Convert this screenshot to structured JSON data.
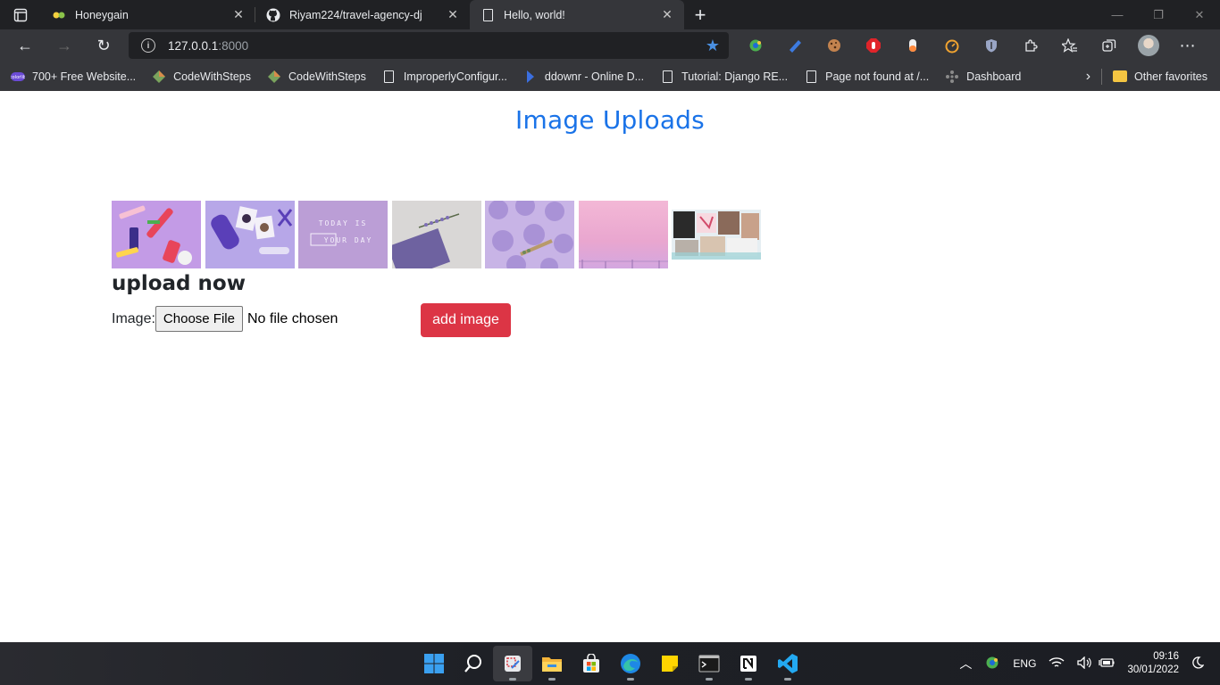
{
  "browser": {
    "tabs": [
      {
        "title": "Honeygain",
        "favicon": "honeygain-icon",
        "active": false
      },
      {
        "title": "Riyam224/travel-agency-dj",
        "favicon": "github-icon",
        "active": false
      },
      {
        "title": "Hello, world!",
        "favicon": "page-icon",
        "active": true
      }
    ],
    "address": {
      "host": "127.0.0.1",
      "port": ":8000"
    },
    "bookmarks": [
      {
        "label": "700+ Free Website...",
        "icon": "colorlib-icon"
      },
      {
        "label": "CodeWithSteps",
        "icon": "codewithsteps-icon"
      },
      {
        "label": "CodeWithSteps",
        "icon": "codewithsteps-icon"
      },
      {
        "label": "ImproperlyConfigur...",
        "icon": "page-icon"
      },
      {
        "label": "ddownr - Online D...",
        "icon": "ddownr-icon"
      },
      {
        "label": "Tutorial: Django RE...",
        "icon": "page-icon"
      },
      {
        "label": "Page not found at /...",
        "icon": "page-icon"
      },
      {
        "label": "Dashboard",
        "icon": "dashboard-icon"
      }
    ],
    "other_favorites": "Other favorites"
  },
  "page": {
    "title": "Image Uploads",
    "gallery": [
      {
        "icon": "thumbnail-purple-makeup"
      },
      {
        "icon": "thumbnail-purple-phone"
      },
      {
        "icon": "thumbnail-today-is-your-day"
      },
      {
        "icon": "thumbnail-lavender-book"
      },
      {
        "icon": "thumbnail-purple-macarons"
      },
      {
        "icon": "thumbnail-pink-sky"
      },
      {
        "icon": "thumbnail-collage"
      }
    ],
    "upload_heading": "upload now",
    "image_label": "Image:",
    "choose_file": "Choose File",
    "no_file": "No file chosen",
    "add_button": "add image"
  },
  "taskbar": {
    "language": "ENG",
    "time": "09:16",
    "date": "30/01/2022"
  }
}
